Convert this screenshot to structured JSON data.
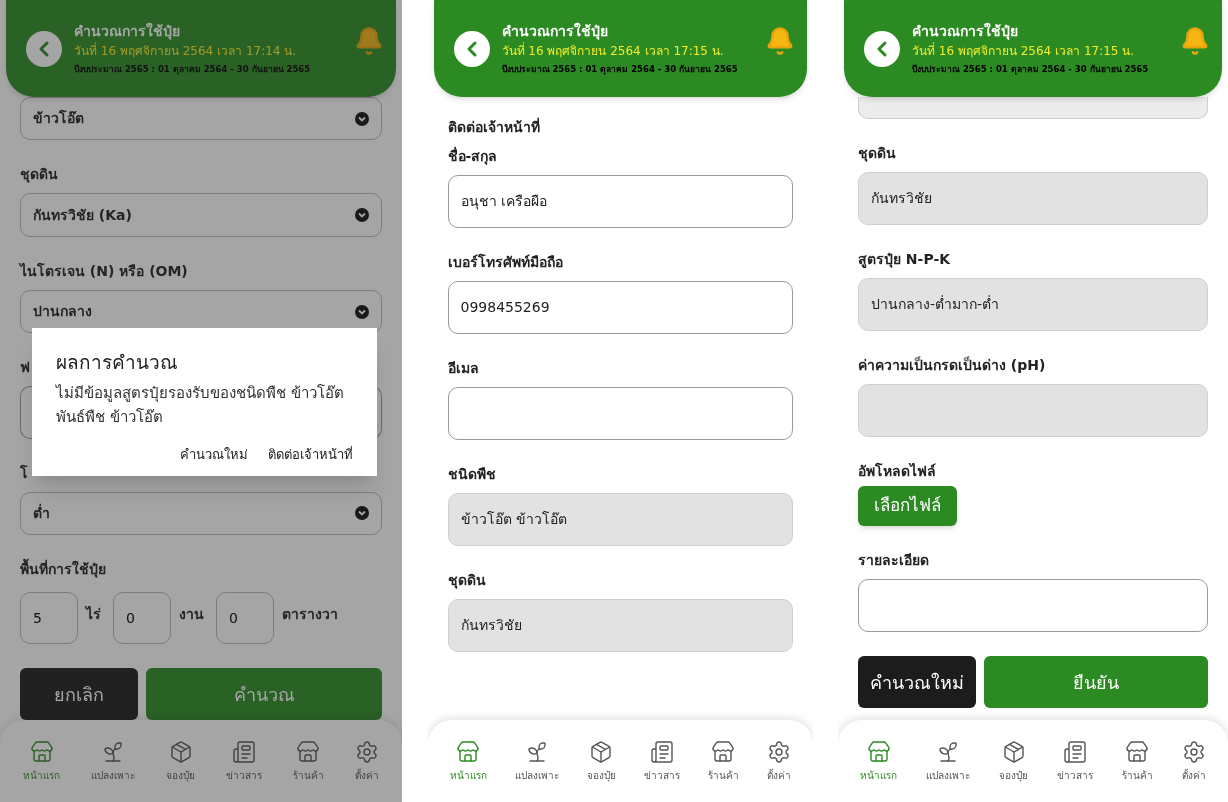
{
  "screens": [
    {
      "header": {
        "title": "คำนวณการใช้ปุ๋ย",
        "date": "วันที่ 16 พฤศจิกายน 2564 เวลา 17:14 น.",
        "budget": "ปีงบประมาณ 2565 : 01 ตุลาคม 2564 - 30 กันยายน 2565"
      },
      "items": [
        {
          "kind": "select",
          "value": "ข้าวโอ๊ต"
        },
        {
          "kind": "label",
          "text": "ชุดดิน"
        },
        {
          "kind": "select",
          "value": "กันทรวิชัย (Ka)"
        },
        {
          "kind": "label",
          "text": "ไนโตรเจน (N) หรือ (OM)"
        },
        {
          "kind": "select",
          "value": "ปานกลาง"
        },
        {
          "kind": "label",
          "text": "ฟ"
        },
        {
          "kind": "covered_input"
        },
        {
          "kind": "label",
          "text": "โ"
        },
        {
          "kind": "select",
          "value": "ต่ำ"
        },
        {
          "kind": "label",
          "text": "พื้นที่การใช้ปุ๋ย"
        },
        {
          "kind": "area",
          "parts": [
            {
              "value": "5",
              "unit": "ไร่"
            },
            {
              "value": "0",
              "unit": "งาน"
            },
            {
              "value": "0",
              "unit": "ตารางวา"
            }
          ]
        },
        {
          "kind": "buttons",
          "buttons": [
            {
              "label": "ยกเลิก"
            },
            {
              "label": "คำนวณ"
            }
          ]
        }
      ],
      "dialog": {
        "title": "ผลการคำนวณ",
        "message": "ไม่มีข้อมูลสูตรปุ๋ยรองรับของชนิดพืช ข้าวโอ๊ต พันธ์พืช ข้าวโอ๊ต",
        "actions": [
          "คำนวณใหม่",
          "ติดต่อเจ้าหน้าที่"
        ]
      },
      "nav": [
        {
          "label": "หน้าแรก",
          "selected": true
        },
        {
          "label": "แปลงเพาะ",
          "selected": false
        },
        {
          "label": "จองปุ๋ย",
          "selected": false
        },
        {
          "label": "ข่าวสาร",
          "selected": false
        },
        {
          "label": "ร้านค้า",
          "selected": false
        },
        {
          "label": "ตั้งค่า",
          "selected": false
        }
      ]
    },
    {
      "header": {
        "title": "คำนวณการใช้ปุ๋ย",
        "date": "วันที่ 16 พฤศจิกายน 2564 เวลา 17:15 น.",
        "budget": "ปีงบประมาณ 2565 : 01 ตุลาคม 2564 - 30 กันยายน 2565"
      },
      "items": [
        {
          "kind": "heading",
          "text": "ติดต่อเจ้าหน้าที่"
        },
        {
          "kind": "label",
          "text": "ชื่อ-สกุล"
        },
        {
          "kind": "input",
          "value": "อนุชา เครือผือ",
          "disabled": false
        },
        {
          "kind": "label",
          "text": "เบอร์โทรศัพท์มือถือ"
        },
        {
          "kind": "input",
          "value": "0998455269",
          "disabled": false
        },
        {
          "kind": "label",
          "text": "อีเมล"
        },
        {
          "kind": "input",
          "disabled": false
        },
        {
          "kind": "label",
          "text": "ชนิดพืช"
        },
        {
          "kind": "input",
          "value": "ข้าวโอ๊ต ข้าวโอ๊ต",
          "disabled": true
        },
        {
          "kind": "label",
          "text": "ชุดดิน"
        },
        {
          "kind": "input",
          "value": "กันทรวิชัย",
          "disabled": true
        }
      ],
      "nav": [
        {
          "label": "หน้าแรก",
          "selected": true
        },
        {
          "label": "แปลงเพาะ",
          "selected": false
        },
        {
          "label": "จองปุ๋ย",
          "selected": false
        },
        {
          "label": "ข่าวสาร",
          "selected": false
        },
        {
          "label": "ร้านค้า",
          "selected": false
        },
        {
          "label": "ตั้งค่า",
          "selected": false
        }
      ]
    },
    {
      "header": {
        "title": "คำนวณการใช้ปุ๋ย",
        "date": "วันที่ 16 พฤศจิกายน 2564 เวลา 17:15 น.",
        "budget": "ปีงบประมาณ 2565 : 01 ตุลาคม 2564 - 30 กันยายน 2565"
      },
      "items": [
        {
          "kind": "cut_input",
          "disabled": true
        },
        {
          "kind": "label",
          "text": "ชุดดิน"
        },
        {
          "kind": "input",
          "value": "กันทรวิชัย",
          "disabled": true
        },
        {
          "kind": "label",
          "text": "สูตรปุ๋ย N-P-K"
        },
        {
          "kind": "input",
          "value": "ปานกลาง-ต่ำมาก-ต่ำ",
          "disabled": true
        },
        {
          "kind": "label",
          "text": "ค่าความเป็นกรดเป็นด่าง (pH)"
        },
        {
          "kind": "input",
          "disabled": true
        },
        {
          "kind": "label",
          "text": "อัพโหลดไฟล์"
        },
        {
          "kind": "file_button",
          "label": "เลือกไฟล์"
        },
        {
          "kind": "label",
          "text": "รายละเอียด"
        },
        {
          "kind": "input",
          "disabled": false
        },
        {
          "kind": "buttons",
          "buttons": [
            {
              "label": "คำนวณใหม่"
            },
            {
              "label": "ยืนยัน"
            }
          ]
        }
      ],
      "nav": [
        {
          "label": "หน้าแรก",
          "selected": true
        },
        {
          "label": "แปลงเพาะ",
          "selected": false
        },
        {
          "label": "จองปุ๋ย",
          "selected": false
        },
        {
          "label": "ข่าวสาร",
          "selected": false
        },
        {
          "label": "ร้านค้า",
          "selected": false
        },
        {
          "label": "ตั้งค่า",
          "selected": false
        }
      ]
    }
  ]
}
